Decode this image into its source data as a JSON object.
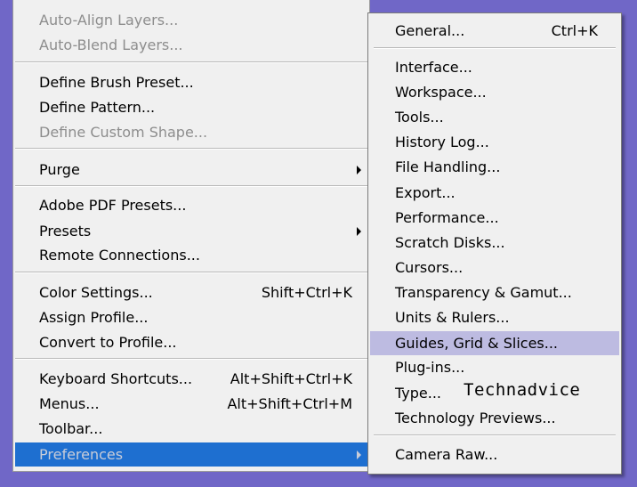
{
  "edit_menu": {
    "items": [
      {
        "label": "Auto-Align Layers..."
      },
      {
        "label": "Auto-Blend Layers..."
      },
      {
        "label": "Define Brush Preset..."
      },
      {
        "label": "Define Pattern..."
      },
      {
        "label": "Define Custom Shape..."
      },
      {
        "label": "Purge"
      },
      {
        "label": "Adobe PDF Presets..."
      },
      {
        "label": "Presets"
      },
      {
        "label": "Remote Connections..."
      },
      {
        "label": "Color Settings...",
        "shortcut": "Shift+Ctrl+K"
      },
      {
        "label": "Assign Profile..."
      },
      {
        "label": "Convert to Profile..."
      },
      {
        "label": "Keyboard Shortcuts...",
        "shortcut": "Alt+Shift+Ctrl+K"
      },
      {
        "label": "Menus...",
        "shortcut": "Alt+Shift+Ctrl+M"
      },
      {
        "label": "Toolbar..."
      },
      {
        "label": "Preferences"
      }
    ]
  },
  "preferences_submenu": {
    "items": [
      {
        "label": "General...",
        "shortcut": "Ctrl+K"
      },
      {
        "label": "Interface..."
      },
      {
        "label": "Workspace..."
      },
      {
        "label": "Tools..."
      },
      {
        "label": "History Log..."
      },
      {
        "label": "File Handling..."
      },
      {
        "label": "Export..."
      },
      {
        "label": "Performance..."
      },
      {
        "label": "Scratch Disks..."
      },
      {
        "label": "Cursors..."
      },
      {
        "label": "Transparency & Gamut..."
      },
      {
        "label": "Units & Rulers..."
      },
      {
        "label": "Guides, Grid & Slices..."
      },
      {
        "label": "Plug-ins..."
      },
      {
        "label": "Type..."
      },
      {
        "label": "Technology Previews..."
      },
      {
        "label": "Camera Raw..."
      }
    ]
  },
  "watermark": "Technadvice",
  "colors": {
    "background": "#7067c7",
    "menu_background": "#f0f0f0",
    "selected_item": "#1e6fd0",
    "hovered_item": "#bdbbe1",
    "disabled_text": "#8d8d8d"
  },
  "icons": {
    "submenu_arrow": "chevron-right-icon"
  }
}
